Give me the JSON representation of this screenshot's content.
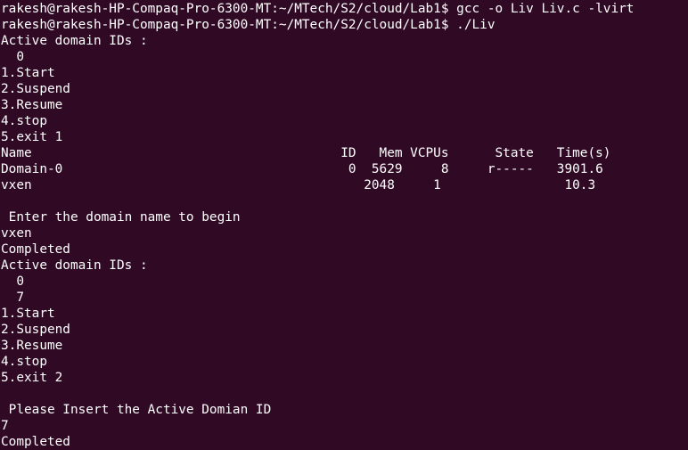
{
  "terminal": {
    "lines": [
      "rakesh@rakesh-HP-Compaq-Pro-6300-MT:~/MTech/S2/cloud/Lab1$ gcc -o Liv Liv.c -lvirt",
      "rakesh@rakesh-HP-Compaq-Pro-6300-MT:~/MTech/S2/cloud/Lab1$ ./Liv",
      "Active domain IDs :",
      "  0",
      "1.Start",
      "2.Suspend",
      "3.Resume",
      "4.stop",
      "5.exit 1",
      "Name                                        ID   Mem VCPUs      State   Time(s)",
      "Domain-0                                     0  5629     8     r-----   3901.6",
      "vxen                                           2048     1                10.3",
      "",
      " Enter the domain name to begin",
      "vxen",
      "Completed",
      "Active domain IDs :",
      "  0",
      "  7",
      "1.Start",
      "2.Suspend",
      "3.Resume",
      "4.stop",
      "5.exit 2",
      "",
      " Please Insert the Active Domian ID",
      "7",
      "Completed"
    ]
  }
}
